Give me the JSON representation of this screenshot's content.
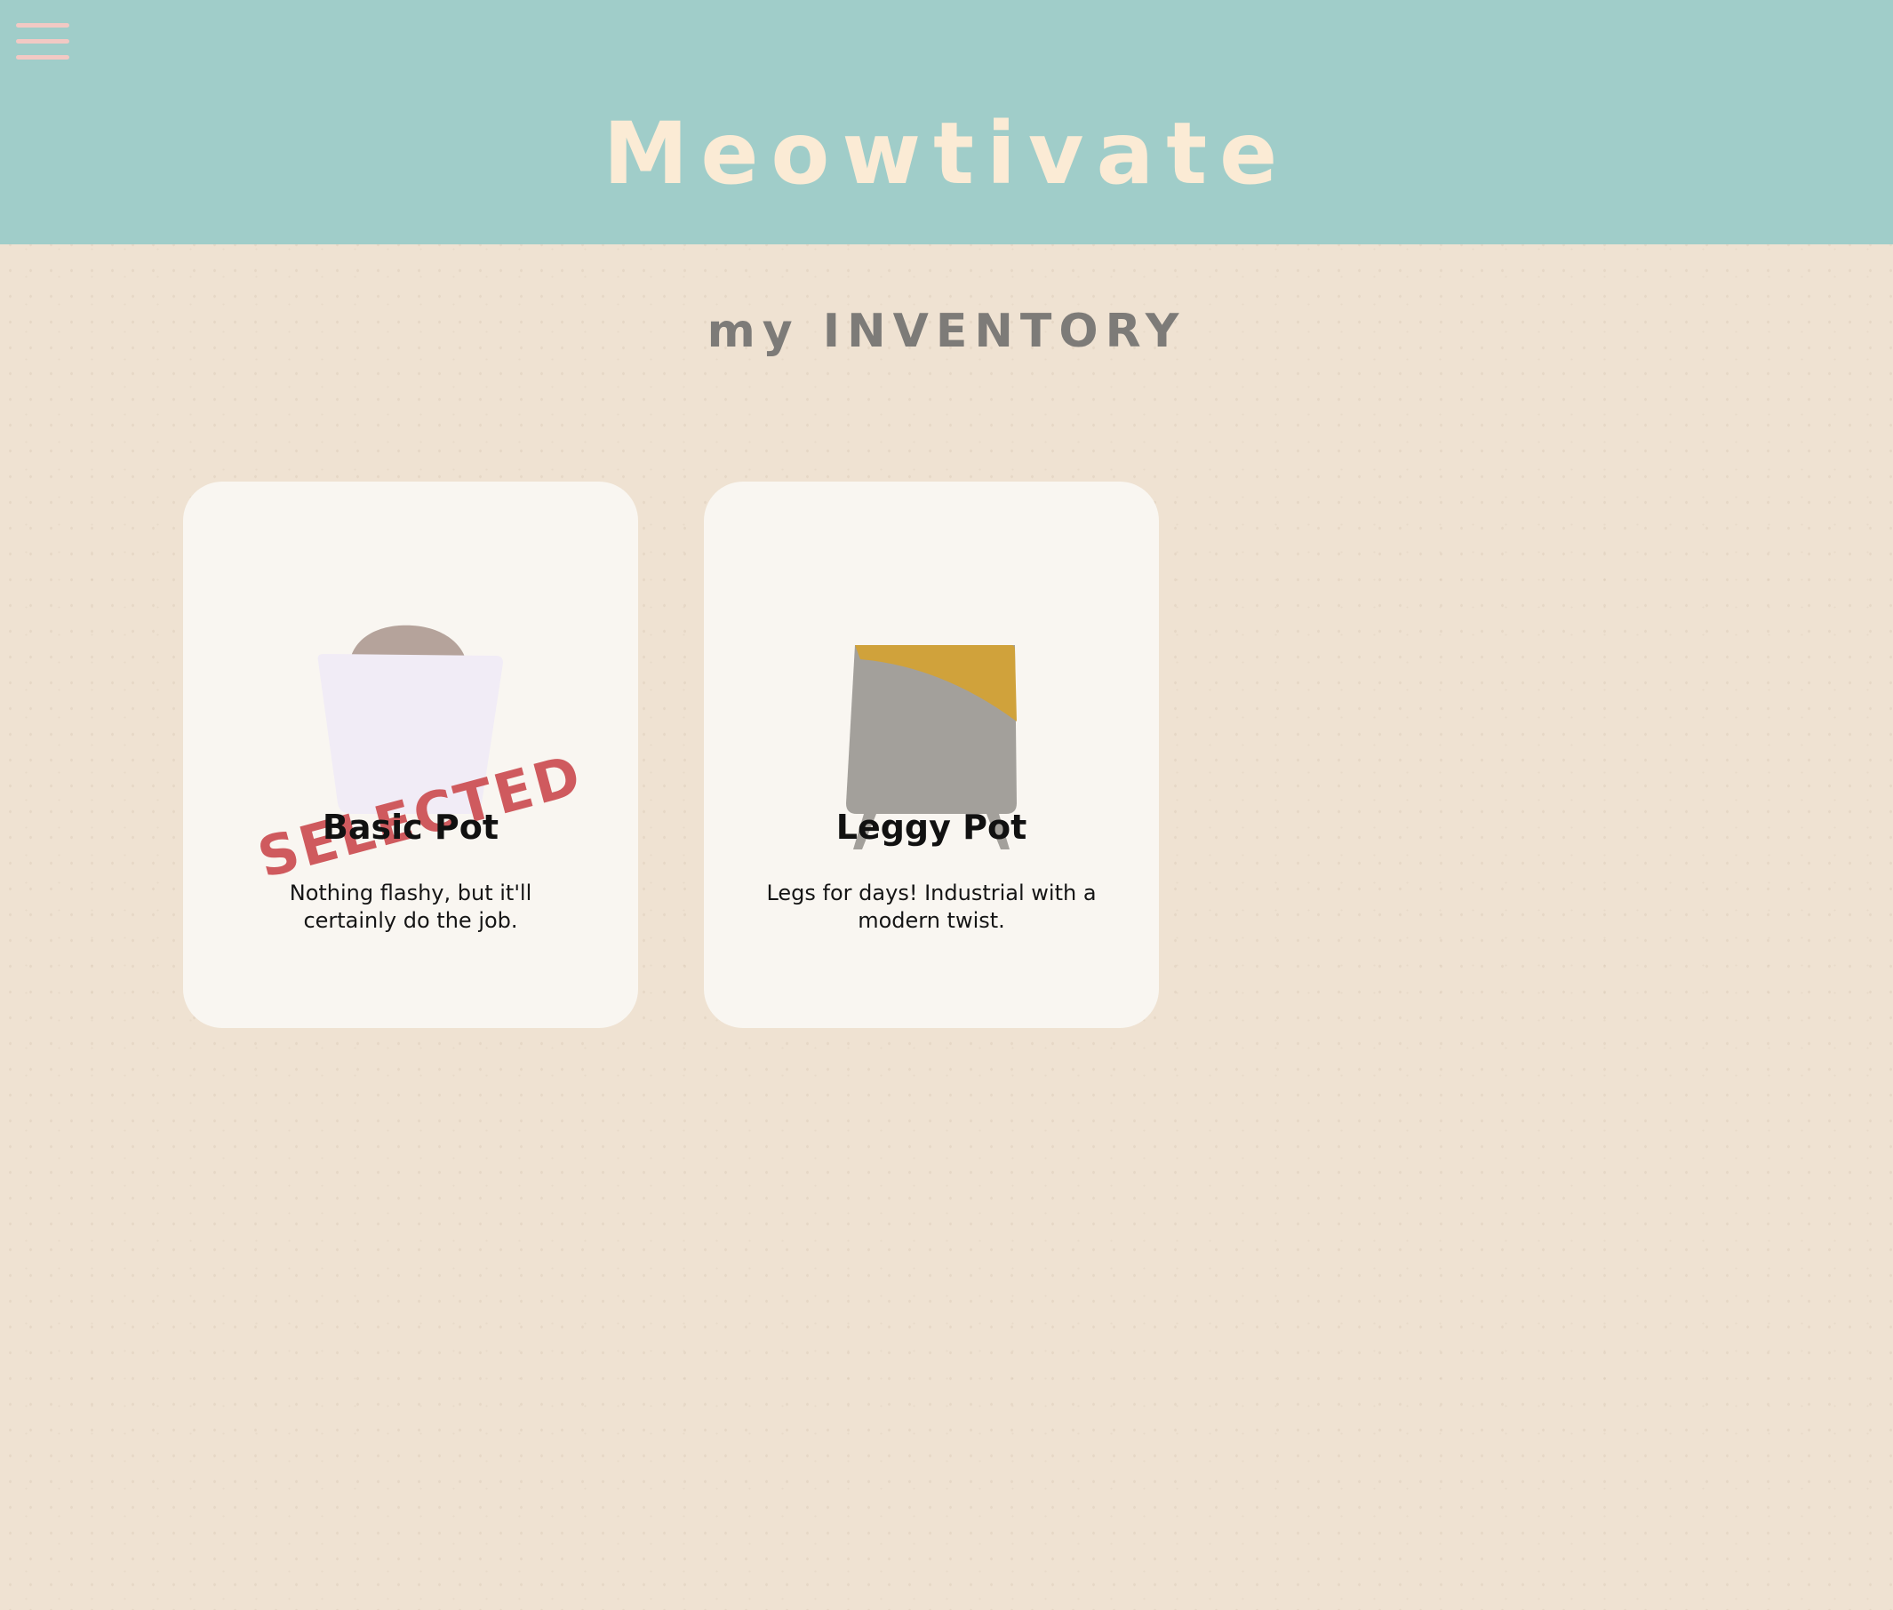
{
  "header": {
    "title": "Meowtivate",
    "menu_icon": "hamburger-menu-icon"
  },
  "page": {
    "heading": "my INVENTORY"
  },
  "inventory": {
    "items": [
      {
        "name": "Basic Pot",
        "description": "Nothing flashy, but it'll certainly do the job.",
        "status": "SELECTED",
        "icon": "basic-pot-icon"
      },
      {
        "name": "Leggy Pot",
        "description": "Legs for days! Industrial with a modern twist.",
        "icon": "leggy-pot-icon"
      }
    ]
  },
  "colors": {
    "header_bg": "#a0cdc9",
    "title": "#fbebd5",
    "page_bg": "#efe2d2",
    "card_bg": "#f9f6f1",
    "heading": "#7d7b78",
    "selected_stamp": "#cf5a5e",
    "menu_icon": "#f2c9c4",
    "basic_pot_body": "#f1ecf6",
    "basic_pot_soil": "#b5a39b",
    "leggy_pot_body": "#a3a09b",
    "leggy_pot_accent": "#d0a23b"
  }
}
